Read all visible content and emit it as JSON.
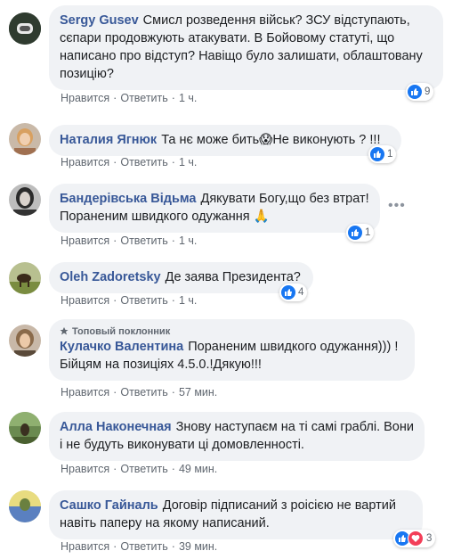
{
  "comments": [
    {
      "author": "Sergy Gusev",
      "text": "Смисл розведення військ? ЗСУ відступають, сєпари продовжують атакувати. В Бойовому статуті, що написано про відступ? Навіщо було залишати, облаштовану позицію?",
      "like": "Нравится",
      "reply": "Ответить",
      "time": "1 ч.",
      "reactions": "9"
    },
    {
      "author": "Наталия Ягнюк",
      "text": "Та нє може бить",
      "text2": "Не виконують ? !!!",
      "emoji": "😱",
      "like": "Нравится",
      "reply": "Ответить",
      "time": "1 ч.",
      "reactions": "1"
    },
    {
      "author": "Бандерівська Відьма",
      "text": "Дякувати Богу,що без втрат! Пораненим швидкого одужання",
      "emoji": "🙏",
      "like": "Нравится",
      "reply": "Ответить",
      "time": "1 ч.",
      "reactions": "1"
    },
    {
      "author": "Oleh Zadoretsky",
      "text": "Де заява Президента?",
      "like": "Нравится",
      "reply": "Ответить",
      "time": "1 ч.",
      "reactions": "4"
    },
    {
      "badge": "Топовый поклонник",
      "author": "Кулачко Валентина",
      "text": "Пораненим швидкого одужання))) ! Бійцям на позиціях 4.5.0.!Дякую!!!",
      "like": "Нравится",
      "reply": "Ответить",
      "time": "57 мин."
    },
    {
      "author": "Алла Наконечная",
      "text": "Знову наступаєм на ті самі граблі. Вони і не будуть виконувати ці домовленності.",
      "like": "Нравится",
      "reply": "Ответить",
      "time": "49 мин."
    },
    {
      "author": "Сашко Гайналь",
      "text": "Договір підписаний з роісією не вартий навіть паперу на якому написаний.",
      "like": "Нравится",
      "reply": "Ответить",
      "time": "39 мин.",
      "reactions": "3"
    }
  ],
  "icons": {
    "like": "like-icon",
    "love": "love-icon",
    "more": "more-options-icon",
    "badge": "top-fan-badge-icon"
  },
  "colors": {
    "author": "#385898",
    "bubble": "#f0f2f5",
    "like": "#1877f2",
    "love": "#f33e58",
    "meta": "#606770"
  }
}
